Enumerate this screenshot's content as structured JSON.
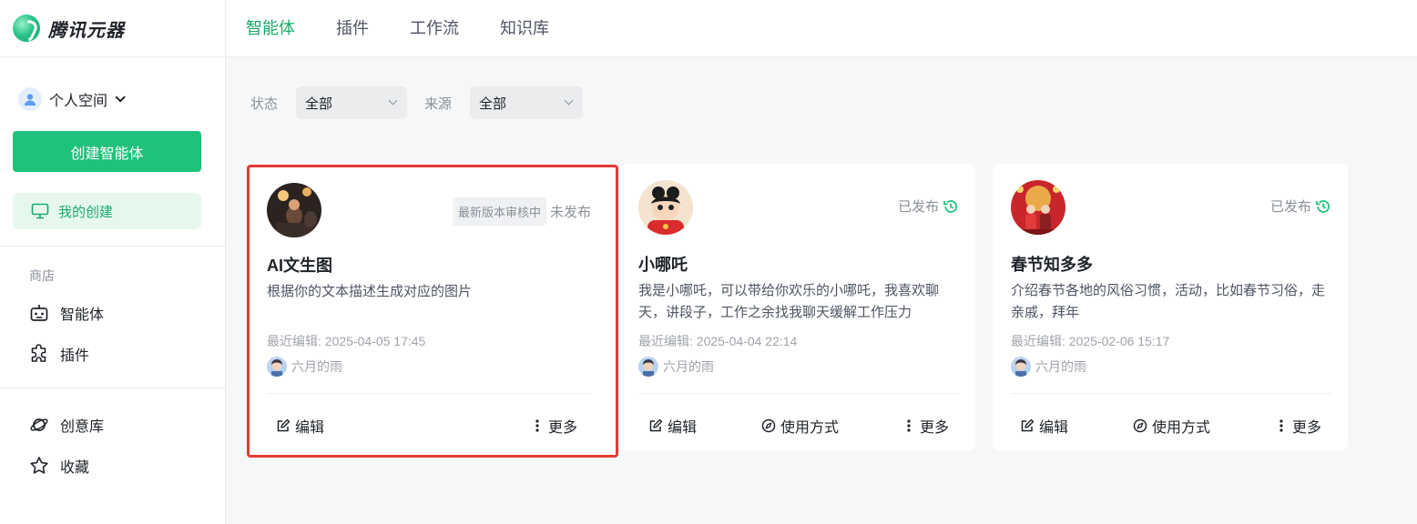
{
  "app": {
    "name": "腾讯元器"
  },
  "sidebar": {
    "space_label": "个人空间",
    "create_button": "创建智能体",
    "my_create": "我的创建",
    "store_title": "商店",
    "store_items": [
      "智能体",
      "插件"
    ],
    "bottom_items": [
      "创意库",
      "收藏"
    ]
  },
  "tabs": [
    "智能体",
    "插件",
    "工作流",
    "知识库"
  ],
  "active_tab": "智能体",
  "filters": {
    "status_label": "状态",
    "status_value": "全部",
    "source_label": "来源",
    "source_value": "全部"
  },
  "cards": [
    {
      "title": "AI文生图",
      "description": "根据你的文本描述生成对应的图片",
      "review_badge": "最新版本审核中",
      "status": "未发布",
      "last_edit": "最近编辑: 2025-04-05 17:45",
      "author": "六月的雨",
      "actions": [
        "编辑",
        "更多"
      ]
    },
    {
      "title": "小哪吒",
      "description": "我是小哪吒，可以带给你欢乐的小哪吒，我喜欢聊天，讲段子，工作之余找我聊天缓解工作压力",
      "status": "已发布",
      "last_edit": "最近编辑: 2025-04-04 22:14",
      "author": "六月的雨",
      "actions": [
        "编辑",
        "使用方式",
        "更多"
      ]
    },
    {
      "title": "春节知多多",
      "description": "介绍春节各地的风俗习惯，活动，比如春节习俗，走亲戚，拜年",
      "status": "已发布",
      "last_edit": "最近编辑: 2025-02-06 15:17",
      "author": "六月的雨",
      "actions": [
        "编辑",
        "使用方式",
        "更多"
      ]
    }
  ],
  "colors": {
    "accent": "#1fc27b",
    "highlight": "#e53935"
  }
}
